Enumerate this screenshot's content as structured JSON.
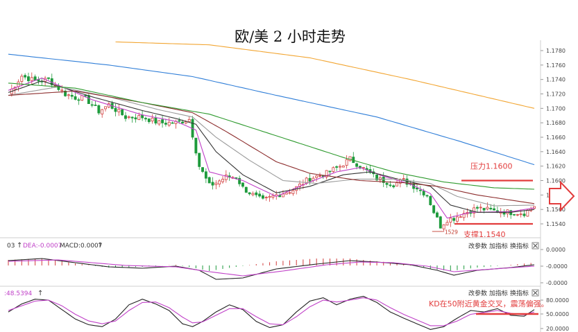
{
  "title": "欧/美 2 小时走势",
  "colors": {
    "up": "#d23c3c",
    "down": "#1e9a3c",
    "ma_magenta": "#c040c8",
    "ma_black": "#333333",
    "ma_gray": "#9a9a9a",
    "ma_darkred": "#8c2c2c",
    "ma_green": "#2e9a2e",
    "ma_blue": "#2f7ed8",
    "ma_orange": "#f2a531",
    "annotation": "#e23c3c"
  },
  "price_panel": {
    "ylim": [
      1.1532,
      1.1798
    ],
    "ticks": [
      "1.1780",
      "1.1760",
      "1.1740",
      "1.1720",
      "1.1700",
      "1.1680",
      "1.1660",
      "1.1640",
      "1.1620",
      "1.1600",
      "1.1580",
      "1.1560",
      "1.1540"
    ],
    "resistance_label": "压力1.1600",
    "resistance_level": 1.16,
    "support_label": "支撑1.1540",
    "support_level": 1.154,
    "low_label": "1529"
  },
  "macd_panel": {
    "header_prefix": "03",
    "header_dea": "DEA:-0.0007",
    "header_macd": "MACD:0.0007",
    "ticks": [
      "0.0000",
      "-0.0000",
      "-0.0000"
    ],
    "buttons": [
      "改参数",
      "加指标",
      "换指标"
    ]
  },
  "kd_panel": {
    "header_value": ":48.5394",
    "ticks": [
      "80.0000",
      "50.0000",
      "20.0000"
    ],
    "buttons": [
      "改参数",
      "加指标",
      "换指标"
    ],
    "note": "KD在50附近黄金交叉，震荡偏强。"
  },
  "chart_data": [
    {
      "type": "candlestick",
      "title": "欧/美 2 小时走势",
      "interval": "2h",
      "ylim": [
        1.1532,
        1.1798
      ],
      "close_path_anchors": [
        [
          0,
          1.172
        ],
        [
          4,
          1.1745
        ],
        [
          8,
          1.1738
        ],
        [
          12,
          1.174
        ],
        [
          17,
          1.172
        ],
        [
          20,
          1.1715
        ],
        [
          23,
          1.1714
        ],
        [
          27,
          1.1696
        ],
        [
          30,
          1.1705
        ],
        [
          35,
          1.1688
        ],
        [
          40,
          1.1688
        ],
        [
          45,
          1.168
        ],
        [
          50,
          1.168
        ],
        [
          54,
          1.1685
        ],
        [
          57,
          1.162
        ],
        [
          60,
          1.1593
        ],
        [
          62,
          1.1597
        ],
        [
          65,
          1.1605
        ],
        [
          68,
          1.1605
        ],
        [
          70,
          1.159
        ],
        [
          73,
          1.158
        ],
        [
          76,
          1.1572
        ],
        [
          80,
          1.158
        ],
        [
          85,
          1.1587
        ],
        [
          90,
          1.1603
        ],
        [
          95,
          1.161
        ],
        [
          99,
          1.162
        ],
        [
          102,
          1.163
        ],
        [
          105,
          1.162
        ],
        [
          110,
          1.1603
        ],
        [
          115,
          1.1595
        ],
        [
          118,
          1.16
        ],
        [
          122,
          1.159
        ],
        [
          125,
          1.158
        ],
        [
          127,
          1.1557
        ],
        [
          129,
          1.1537
        ],
        [
          131,
          1.1546
        ],
        [
          133,
          1.1548
        ],
        [
          135,
          1.1553
        ],
        [
          140,
          1.1562
        ],
        [
          145,
          1.1558
        ],
        [
          150,
          1.1556
        ],
        [
          154,
          1.1555
        ],
        [
          157,
          1.1565
        ]
      ],
      "moving_averages": [
        {
          "color": "#c040c8",
          "anchors": [
            [
              0,
              1.1725
            ],
            [
              10,
              1.1742
            ],
            [
              25,
              1.1712
            ],
            [
              40,
              1.1691
            ],
            [
              50,
              1.1682
            ],
            [
              56,
              1.167
            ],
            [
              60,
              1.1612
            ],
            [
              70,
              1.16
            ],
            [
              80,
              1.1578
            ],
            [
              90,
              1.1598
            ],
            [
              98,
              1.1612
            ],
            [
              105,
              1.1618
            ],
            [
              112,
              1.1606
            ],
            [
              120,
              1.1595
            ],
            [
              126,
              1.1582
            ],
            [
              131,
              1.1548
            ],
            [
              138,
              1.1556
            ],
            [
              150,
              1.1557
            ],
            [
              157,
              1.1562
            ]
          ]
        },
        {
          "color": "#333333",
          "anchors": [
            [
              0,
              1.1722
            ],
            [
              10,
              1.1738
            ],
            [
              25,
              1.1716
            ],
            [
              40,
              1.1697
            ],
            [
              50,
              1.1686
            ],
            [
              56,
              1.1678
            ],
            [
              62,
              1.164
            ],
            [
              70,
              1.1608
            ],
            [
              80,
              1.1583
            ],
            [
              90,
              1.1592
            ],
            [
              100,
              1.1608
            ],
            [
              108,
              1.1612
            ],
            [
              118,
              1.16
            ],
            [
              126,
              1.1592
            ],
            [
              132,
              1.1566
            ],
            [
              140,
              1.1556
            ],
            [
              150,
              1.1556
            ],
            [
              157,
              1.156
            ]
          ]
        },
        {
          "color": "#9a9a9a",
          "anchors": [
            [
              0,
              1.1718
            ],
            [
              15,
              1.173
            ],
            [
              30,
              1.1716
            ],
            [
              45,
              1.1698
            ],
            [
              55,
              1.1688
            ],
            [
              62,
              1.166
            ],
            [
              72,
              1.1628
            ],
            [
              82,
              1.16
            ],
            [
              92,
              1.1596
            ],
            [
              104,
              1.1602
            ],
            [
              116,
              1.1602
            ],
            [
              126,
              1.1596
            ],
            [
              134,
              1.1578
            ],
            [
              145,
              1.1565
            ],
            [
              157,
              1.1566
            ]
          ]
        },
        {
          "color": "#8c2c2c",
          "anchors": [
            [
              0,
              1.1718
            ],
            [
              20,
              1.1724
            ],
            [
              40,
              1.1708
            ],
            [
              55,
              1.1694
            ],
            [
              65,
              1.1668
            ],
            [
              80,
              1.1626
            ],
            [
              90,
              1.161
            ],
            [
              105,
              1.16
            ],
            [
              118,
              1.1597
            ],
            [
              128,
              1.1592
            ],
            [
              140,
              1.158
            ],
            [
              157,
              1.1568
            ]
          ]
        },
        {
          "color": "#2e9a2e",
          "anchors": [
            [
              0,
              1.1735
            ],
            [
              20,
              1.1728
            ],
            [
              40,
              1.1708
            ],
            [
              60,
              1.1692
            ],
            [
              80,
              1.1662
            ],
            [
              100,
              1.1632
            ],
            [
              115,
              1.1612
            ],
            [
              130,
              1.1598
            ],
            [
              145,
              1.159
            ],
            [
              157,
              1.1588
            ]
          ]
        },
        {
          "color": "#2f7ed8",
          "anchors": [
            [
              0,
              1.1775
            ],
            [
              30,
              1.176
            ],
            [
              55,
              1.1744
            ],
            [
              80,
              1.1718
            ],
            [
              110,
              1.1688
            ],
            [
              135,
              1.1654
            ],
            [
              157,
              1.1622
            ]
          ]
        },
        {
          "color": "#f2a531",
          "anchors": [
            [
              32,
              1.1792
            ],
            [
              60,
              1.1788
            ],
            [
              90,
              1.177
            ],
            [
              120,
              1.174
            ],
            [
              157,
              1.17
            ]
          ]
        }
      ],
      "annotations": [
        {
          "text": "压力1.1600",
          "level": 1.16
        },
        {
          "text": "支撑1.1540",
          "level": 1.154
        },
        {
          "text": "1529",
          "level": 1.1529
        }
      ]
    },
    {
      "type": "macd",
      "title": "DEA:-0.0007 MACD:0.0007",
      "dif_anchors": [
        [
          0,
          0.35
        ],
        [
          10,
          0.5
        ],
        [
          20,
          0.2
        ],
        [
          30,
          -0.1
        ],
        [
          40,
          -0.2
        ],
        [
          50,
          -0.05
        ],
        [
          57,
          -0.35
        ],
        [
          62,
          -1.0
        ],
        [
          70,
          -0.9
        ],
        [
          80,
          -0.25
        ],
        [
          92,
          0.1
        ],
        [
          102,
          0.35
        ],
        [
          110,
          0.25
        ],
        [
          120,
          0.05
        ],
        [
          128,
          -0.35
        ],
        [
          133,
          -0.7
        ],
        [
          140,
          -0.35
        ],
        [
          150,
          -0.15
        ],
        [
          157,
          0.05
        ]
      ],
      "dea_anchors": [
        [
          0,
          0.3
        ],
        [
          15,
          0.4
        ],
        [
          25,
          0.2
        ],
        [
          35,
          0.0
        ],
        [
          50,
          -0.1
        ],
        [
          60,
          -0.45
        ],
        [
          70,
          -0.75
        ],
        [
          82,
          -0.4
        ],
        [
          95,
          0.05
        ],
        [
          105,
          0.25
        ],
        [
          115,
          0.2
        ],
        [
          125,
          -0.05
        ],
        [
          133,
          -0.45
        ],
        [
          142,
          -0.3
        ],
        [
          157,
          -0.05
        ]
      ],
      "hist_anchors": [
        [
          0,
          0.4
        ],
        [
          10,
          0.5
        ],
        [
          20,
          0.15
        ],
        [
          30,
          -0.15
        ],
        [
          40,
          -0.1
        ],
        [
          50,
          0.05
        ],
        [
          56,
          -0.2
        ],
        [
          60,
          -0.4
        ],
        [
          68,
          -0.1
        ],
        [
          80,
          0.3
        ],
        [
          92,
          0.5
        ],
        [
          102,
          0.5
        ],
        [
          110,
          0.3
        ],
        [
          118,
          0.15
        ],
        [
          126,
          -0.25
        ],
        [
          132,
          -0.4
        ],
        [
          140,
          -0.15
        ],
        [
          150,
          0.05
        ],
        [
          157,
          0.2
        ]
      ],
      "ticks": [
        "0.0000",
        "-0.0000",
        "-0.0000"
      ]
    },
    {
      "type": "kd",
      "title": ":48.5394",
      "ylim": [
        10,
        95
      ],
      "k_anchors": [
        [
          0,
          55
        ],
        [
          4,
          72
        ],
        [
          8,
          82
        ],
        [
          12,
          80
        ],
        [
          16,
          60
        ],
        [
          20,
          40
        ],
        [
          24,
          28
        ],
        [
          28,
          24
        ],
        [
          32,
          40
        ],
        [
          36,
          70
        ],
        [
          40,
          82
        ],
        [
          44,
          72
        ],
        [
          48,
          58
        ],
        [
          52,
          30
        ],
        [
          55,
          24
        ],
        [
          58,
          35
        ],
        [
          62,
          55
        ],
        [
          66,
          70
        ],
        [
          70,
          60
        ],
        [
          74,
          35
        ],
        [
          78,
          22
        ],
        [
          82,
          28
        ],
        [
          86,
          55
        ],
        [
          90,
          78
        ],
        [
          94,
          85
        ],
        [
          98,
          70
        ],
        [
          102,
          82
        ],
        [
          106,
          88
        ],
        [
          110,
          75
        ],
        [
          114,
          55
        ],
        [
          118,
          42
        ],
        [
          122,
          30
        ],
        [
          126,
          18
        ],
        [
          130,
          24
        ],
        [
          134,
          42
        ],
        [
          138,
          58
        ],
        [
          142,
          55
        ],
        [
          146,
          62
        ],
        [
          150,
          48
        ],
        [
          154,
          46
        ],
        [
          157,
          60
        ]
      ],
      "d_anchors": [
        [
          0,
          58
        ],
        [
          4,
          68
        ],
        [
          8,
          78
        ],
        [
          12,
          80
        ],
        [
          16,
          68
        ],
        [
          20,
          50
        ],
        [
          24,
          36
        ],
        [
          28,
          30
        ],
        [
          32,
          36
        ],
        [
          36,
          58
        ],
        [
          40,
          75
        ],
        [
          44,
          76
        ],
        [
          48,
          64
        ],
        [
          52,
          44
        ],
        [
          55,
          32
        ],
        [
          58,
          34
        ],
        [
          62,
          48
        ],
        [
          66,
          62
        ],
        [
          70,
          62
        ],
        [
          74,
          45
        ],
        [
          78,
          30
        ],
        [
          82,
          28
        ],
        [
          86,
          45
        ],
        [
          90,
          66
        ],
        [
          94,
          80
        ],
        [
          98,
          76
        ],
        [
          102,
          80
        ],
        [
          106,
          85
        ],
        [
          110,
          80
        ],
        [
          114,
          64
        ],
        [
          118,
          50
        ],
        [
          122,
          38
        ],
        [
          126,
          26
        ],
        [
          130,
          26
        ],
        [
          134,
          36
        ],
        [
          138,
          50
        ],
        [
          142,
          54
        ],
        [
          146,
          58
        ],
        [
          150,
          52
        ],
        [
          154,
          49
        ],
        [
          157,
          55
        ]
      ],
      "ticks": [
        "80.0000",
        "50.0000",
        "20.0000"
      ],
      "annotation": "KD在50附近黄金交叉，震荡偏强。"
    }
  ]
}
